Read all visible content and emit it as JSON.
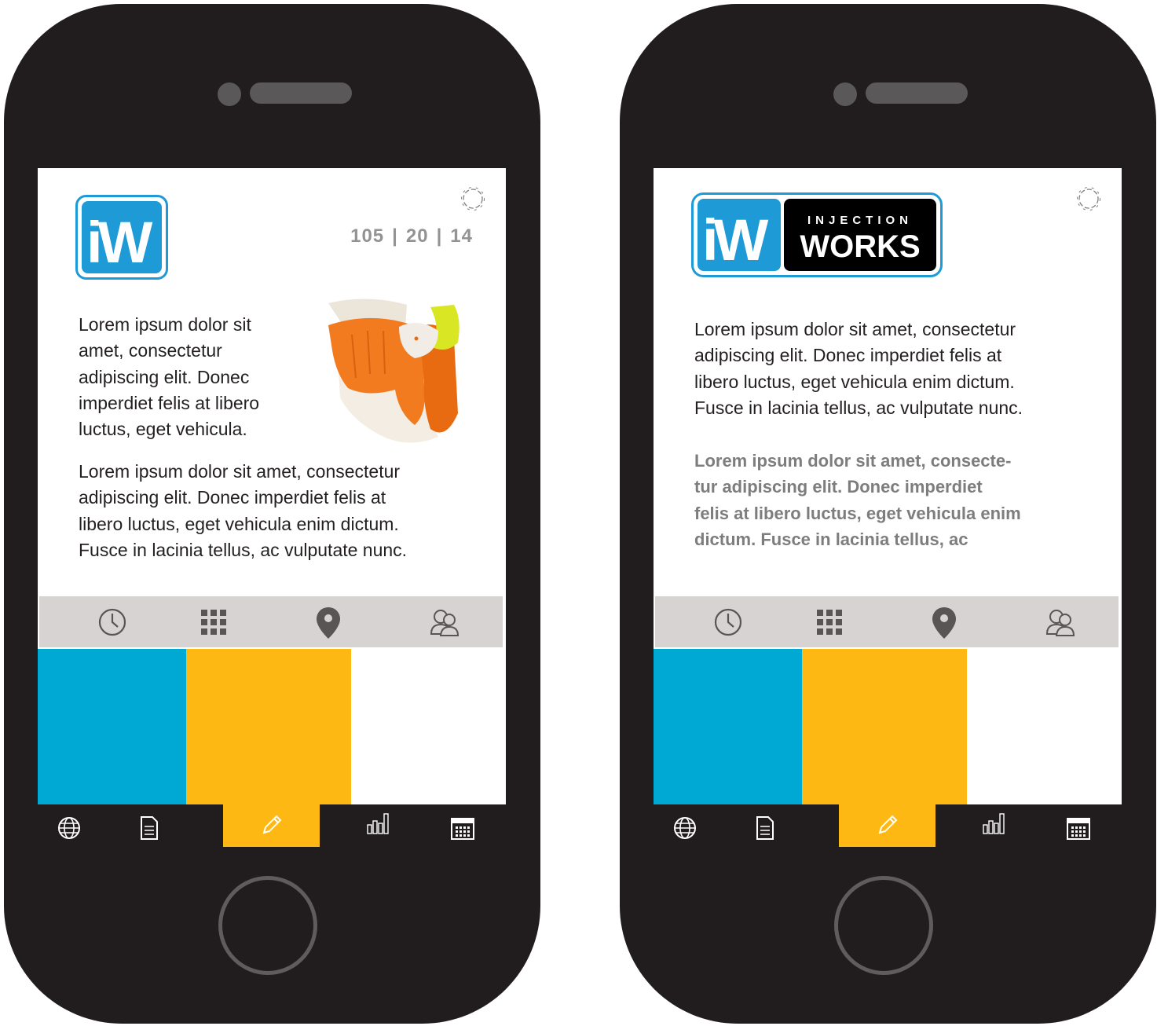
{
  "left_screen": {
    "stats": [
      "105",
      "20",
      "14"
    ],
    "stats_separator": "|",
    "paragraph_1": "Lorem ipsum dolor sit amet, consectetur adipiscing elit. Donec imperdiet felis at libero luctus, eget vehicula.",
    "paragraph_1_lines": [
      "Lorem ipsum dolor sit",
      "amet, consectetur",
      "adipiscing elit. Donec",
      "imperdiet felis at libero",
      "luctus, eget vehicula."
    ],
    "paragraph_2_lines": [
      "Lorem ipsum dolor sit amet, consectetur",
      "adipiscing elit. Donec imperdiet felis at",
      "libero luctus, eget vehicula enim dictum.",
      "Fusce in lacinia tellus, ac vulputate nunc."
    ]
  },
  "right_screen": {
    "logo_text_top": "INJECTION",
    "logo_text_bottom": "WORKS",
    "paragraph_1_lines": [
      "Lorem ipsum dolor sit amet, consectetur",
      "adipiscing elit. Donec imperdiet felis at",
      "libero luctus, eget vehicula enim dictum.",
      "Fusce in lacinia tellus, ac vulputate nunc."
    ],
    "paragraph_2_lines": [
      "Lorem ipsum dolor sit amet, consecte-",
      "tur adipiscing elit. Donec imperdiet",
      "felis at libero luctus, eget vehicula enim",
      "dictum. Fusce in lacinia tellus, ac"
    ]
  },
  "logo_letters": "iW",
  "icons": {
    "iconbar": [
      "clock-icon",
      "grid-icon",
      "location-pin-icon",
      "users-icon"
    ],
    "tabbar": [
      "globe-icon",
      "document-icon",
      "pencil-icon",
      "bar-chart-icon",
      "calendar-icon"
    ],
    "active_tab": "pencil-icon"
  },
  "colors": {
    "phone_body": "#211d1e",
    "brand_blue": "#00a8d4",
    "brand_yellow": "#fdb813",
    "iconbar_bg": "#d8d3d3",
    "icon_gray": "#5a5555"
  }
}
